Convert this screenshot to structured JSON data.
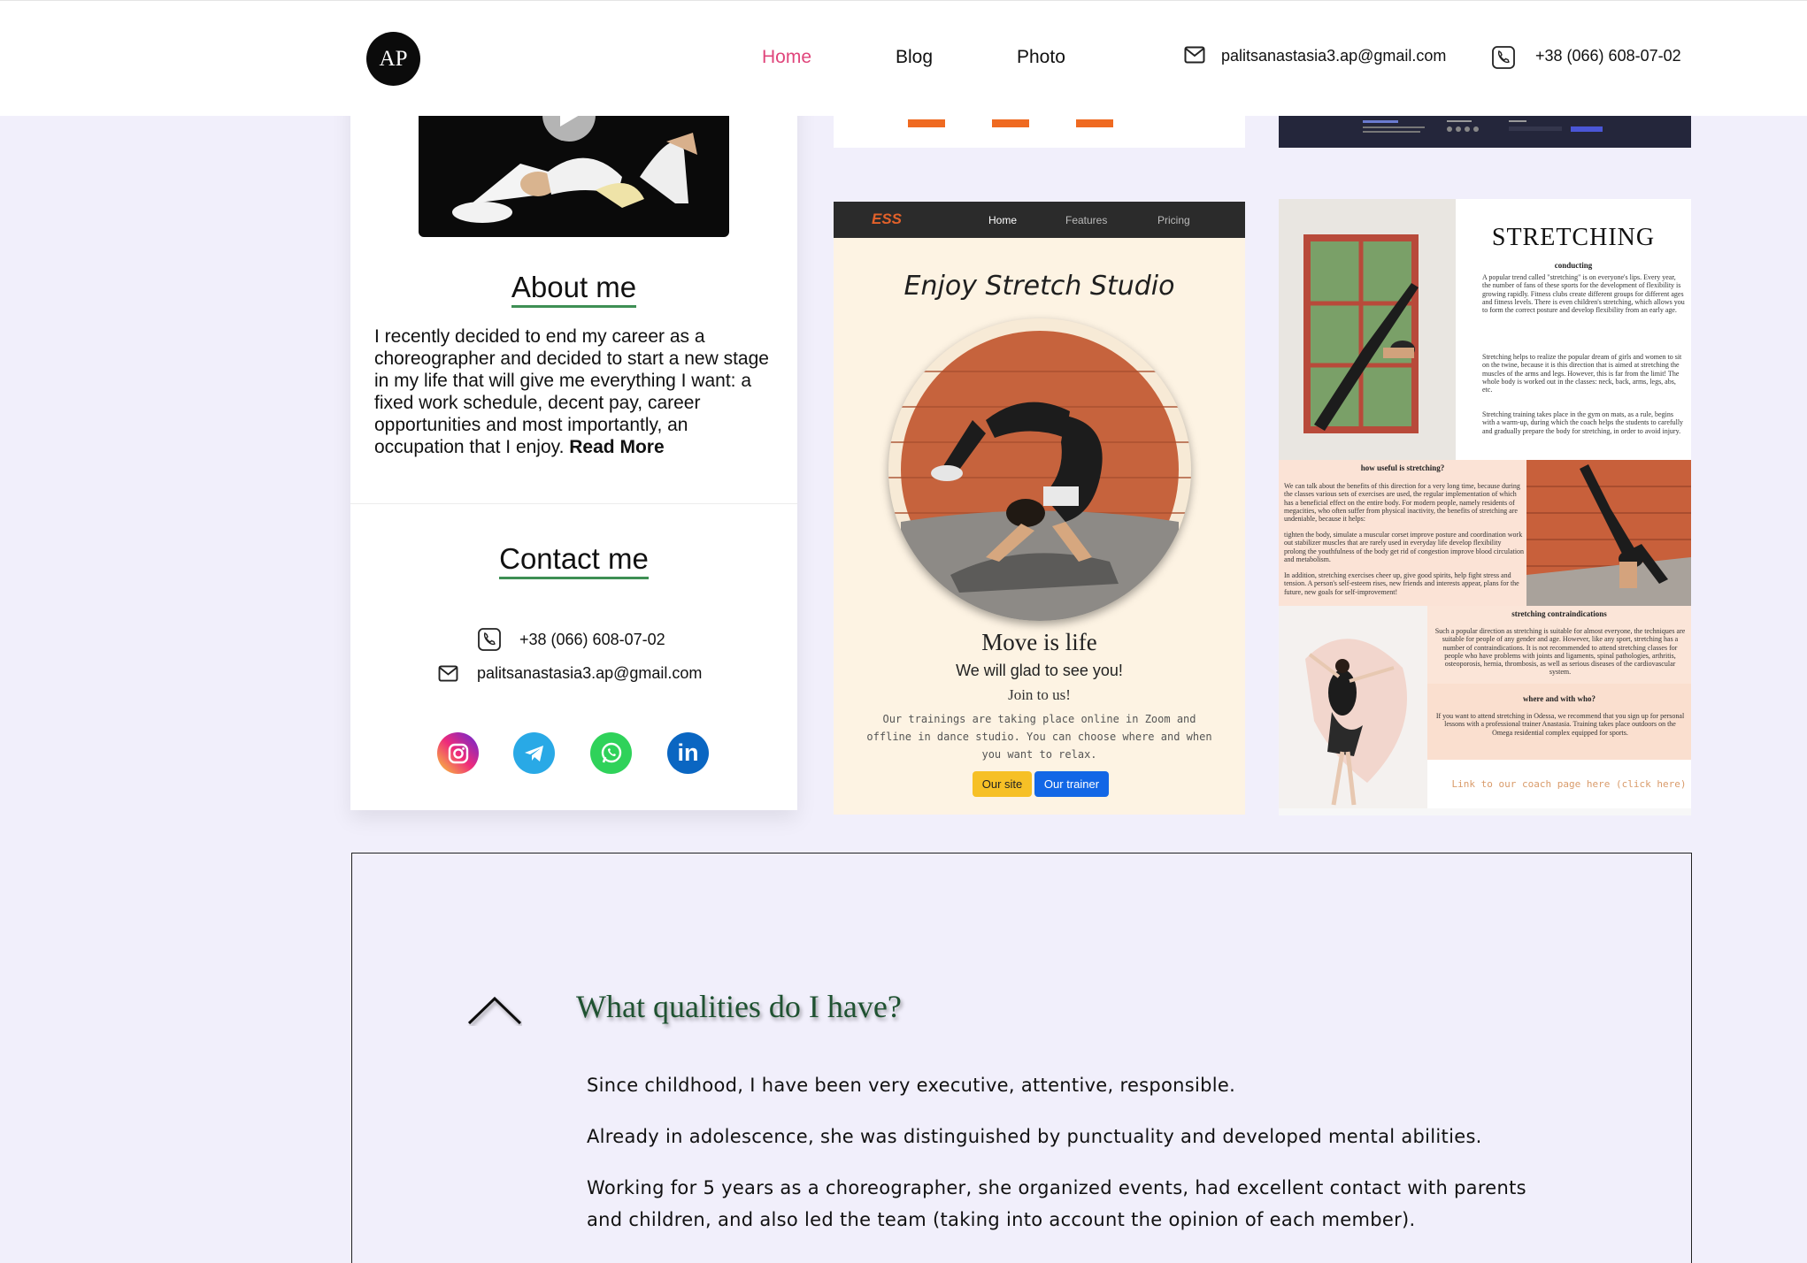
{
  "header": {
    "logo": "AP",
    "nav": [
      "Home",
      "Blog",
      "Photo"
    ],
    "email": "palitsanastasia3.ap@gmail.com",
    "phone": "+38 (066) 608-07-02",
    "active_color": "#e0457b"
  },
  "profile": {
    "about_title": "About me",
    "about_text": "I recently decided to end my career as a choreographer and decided to start a new stage in my life that will give me everything I want: a fixed work schedule, decent pay, career opportunities and most importantly, an occupation that I enjoy.",
    "read_more": "Read More",
    "contact_title": "Contact me",
    "phone": "+38 (066) 608-07-02",
    "email": "palitsanastasia3.ap@gmail.com",
    "socials": [
      "instagram-icon",
      "telegram-icon",
      "whatsapp-icon",
      "linkedin-icon"
    ]
  },
  "ess": {
    "logo": "ESS",
    "nav": [
      "Home",
      "Features",
      "Pricing"
    ],
    "title": "Enjoy Stretch Studio",
    "motto": "Move is life",
    "glad": "We will glad to see you!",
    "join": "Join to us!",
    "desc1": "Our trainings are taking place online in Zoom and",
    "desc2": "offline in dance studio. You can choose where and when",
    "desc3": "you want to relax.",
    "btn_site": "Our site",
    "btn_trainer": "Our trainer"
  },
  "stretching": {
    "title": "STRETCHING",
    "sub1": "conducting",
    "text1": "A popular trend called \"stretching\" is on everyone's lips. Every year, the number of fans of these sports for the development of flexibility is growing rapidly. Fitness clubs create different groups for different ages and fitness levels. There is even children's stretching, which allows you to form the correct posture and develop flexibility from an early age.",
    "text2": "Stretching helps to realize the popular dream of girls and women to sit on the twine, because it is this direction that is aimed at stretching the muscles of the arms and legs. However, this is far from the limit! The whole body is worked out in the classes: neck, back, arms, legs, abs, etc.",
    "text3": "Stretching training takes place in the gym on mats, as a rule, begins with a warm-up, during which the coach helps the students to carefully and gradually prepare the body for stretching, in order to avoid injury.",
    "sub2": "how useful is stretching?",
    "text4": "We can talk about the benefits of this direction for a very long time, because during the classes various sets of exercises are used, the regular implementation of which has a beneficial effect on the entire body. For modern people, namely residents of megacities, who often suffer from physical inactivity, the benefits of stretching are undeniable, because it helps:",
    "text5": "tighten the body, simulate a muscular corset improve posture and coordination work out stabilizer muscles that are rarely used in everyday life develop flexibility prolong the youthfulness of the body get rid of congestion improve blood circulation and metabolism.",
    "text6": "In addition, stretching exercises cheer up, give good spirits, help fight stress and tension. A person's self-esteem rises, new friends and interests appear, plans for the future, new goals for self-improvement!",
    "sub3": "stretching contraindications",
    "text7": "Such a popular direction as stretching is suitable for almost everyone, the techniques are suitable for people of any gender and age. However, like any sport, stretching has a number of contraindications. It is not recommended to attend stretching classes for people who have problems with joints and ligaments, spinal pathologies, arthritis, osteoporosis, hernia, thrombosis, as well as serious diseases of the cardiovascular system.",
    "sub4": "where and with who?",
    "text8": "If you want to attend stretching in Odessa, we recommend that you sign up for personal lessons with a professional trainer Anastasia. Training takes place outdoors on the Omega residential complex equipped for sports.",
    "link": "Link to our coach page here (click here)"
  },
  "qualities": {
    "title": "What qualities do I have?",
    "p1": "Since childhood, I have been very executive, attentive, responsible.",
    "p2": "Already in adolescence, she was distinguished by punctuality and developed mental abilities.",
    "p3a": "Working for 5 years as a choreographer, she organized events, had excellent contact with parents",
    "p3b": "and children, and also led the team (taking into account the opinion of each member)."
  }
}
